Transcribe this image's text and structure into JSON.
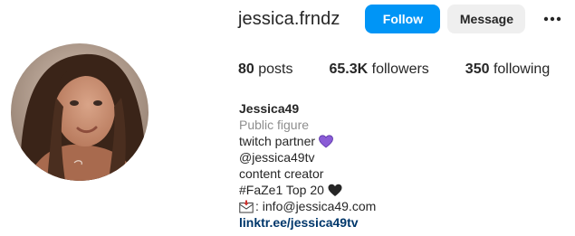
{
  "profile": {
    "username": "jessica.frndz",
    "follow_label": "Follow",
    "message_label": "Message"
  },
  "stats": {
    "posts_count": "80",
    "posts_label": "posts",
    "followers_count": "65.3K",
    "followers_label": "followers",
    "following_count": "350",
    "following_label": "following"
  },
  "bio": {
    "name": "Jessica49",
    "category": "Public figure",
    "lines": [
      "twitch partner",
      "@jessica49tv",
      "content creator",
      "#FaZe1 Top 20",
      ": info@jessica49.com"
    ],
    "link": "linktr.ee/jessica49tv"
  },
  "icons": {
    "more": "more-options-icon",
    "purple_heart": "purple-heart-icon",
    "black_heart": "black-heart-icon",
    "envelope": "envelope-icon"
  },
  "colors": {
    "accent": "#0095f6",
    "secondary_button": "#efefef",
    "link": "#00376b",
    "muted": "#8e8e8e",
    "purple_heart": "#8a5cd6"
  }
}
